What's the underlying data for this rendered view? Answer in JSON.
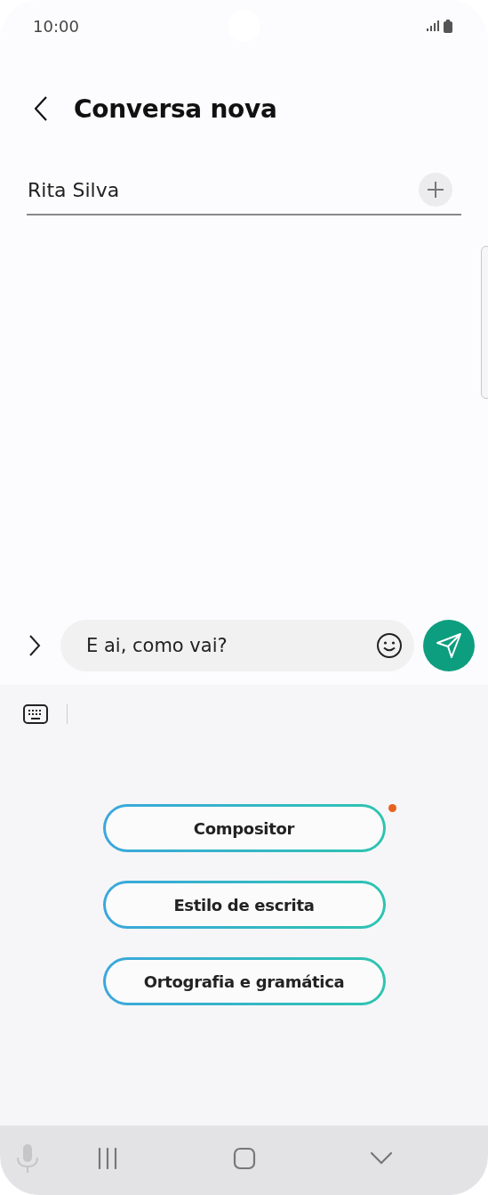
{
  "status_bar": {
    "time": "10:00"
  },
  "header": {
    "title": "Conversa nova"
  },
  "recipient": {
    "value": "Rita Silva"
  },
  "composer": {
    "value": "E ai, como vai?"
  },
  "assistant": {
    "chips": [
      {
        "label": "Compositor",
        "new": true
      },
      {
        "label": "Estilo de escrita",
        "new": false
      },
      {
        "label": "Ortografia e gramática",
        "new": false
      }
    ]
  },
  "nav_bar": {
    "voice_input_enabled": false
  }
}
